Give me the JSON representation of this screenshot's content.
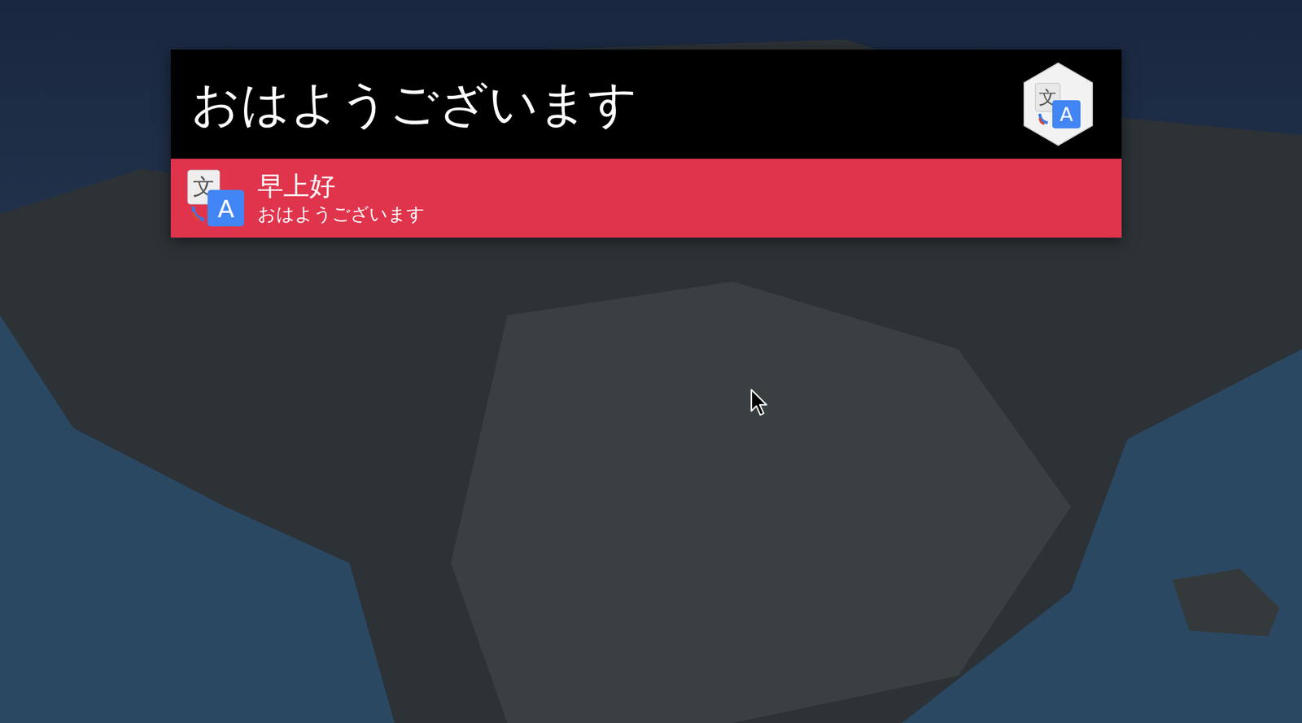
{
  "launcher": {
    "query": "おはようございます",
    "icon": {
      "source_glyph": "文",
      "target_glyph": "A"
    }
  },
  "results": [
    {
      "title": "早上好",
      "subtitle": "おはようございます",
      "selected": true
    }
  ]
}
